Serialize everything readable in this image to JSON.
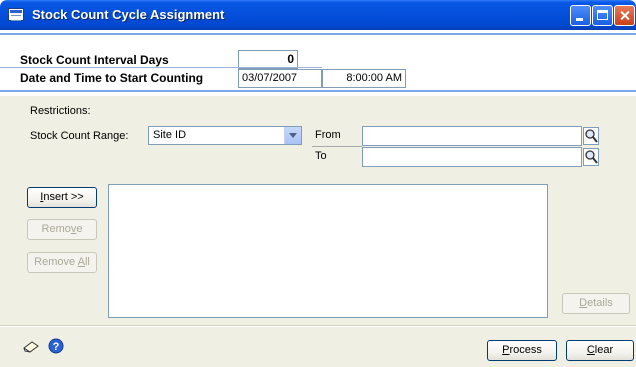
{
  "window": {
    "title": "Stock Count Cycle Assignment"
  },
  "header": {
    "interval_label": "Stock Count Interval Days",
    "interval_value": "0",
    "start_label": "Date and Time to Start Counting",
    "start_date": "03/07/2007",
    "start_time": "8:00:00 AM"
  },
  "restrictions": {
    "label": "Restrictions:",
    "range_label": "Stock Count Range:",
    "range_value": "Site ID",
    "from_label": "From",
    "to_label": "To",
    "from_value": "",
    "to_value": ""
  },
  "buttons": {
    "insert": {
      "pre": "",
      "key": "I",
      "post": "nsert >>"
    },
    "remove": {
      "pre": "Remo",
      "key": "v",
      "post": "e"
    },
    "remove_all": {
      "pre": "Remove ",
      "key": "A",
      "post": "ll"
    },
    "details": {
      "pre": "",
      "key": "D",
      "post": "etails"
    },
    "process": {
      "pre": "",
      "key": "P",
      "post": "rocess"
    },
    "clear": {
      "pre": "",
      "key": "C",
      "post": "lear"
    }
  },
  "restrictions_list": [],
  "icons": {
    "note": "note-icon",
    "help": "help-icon",
    "lookup": "magnifier-icon"
  }
}
